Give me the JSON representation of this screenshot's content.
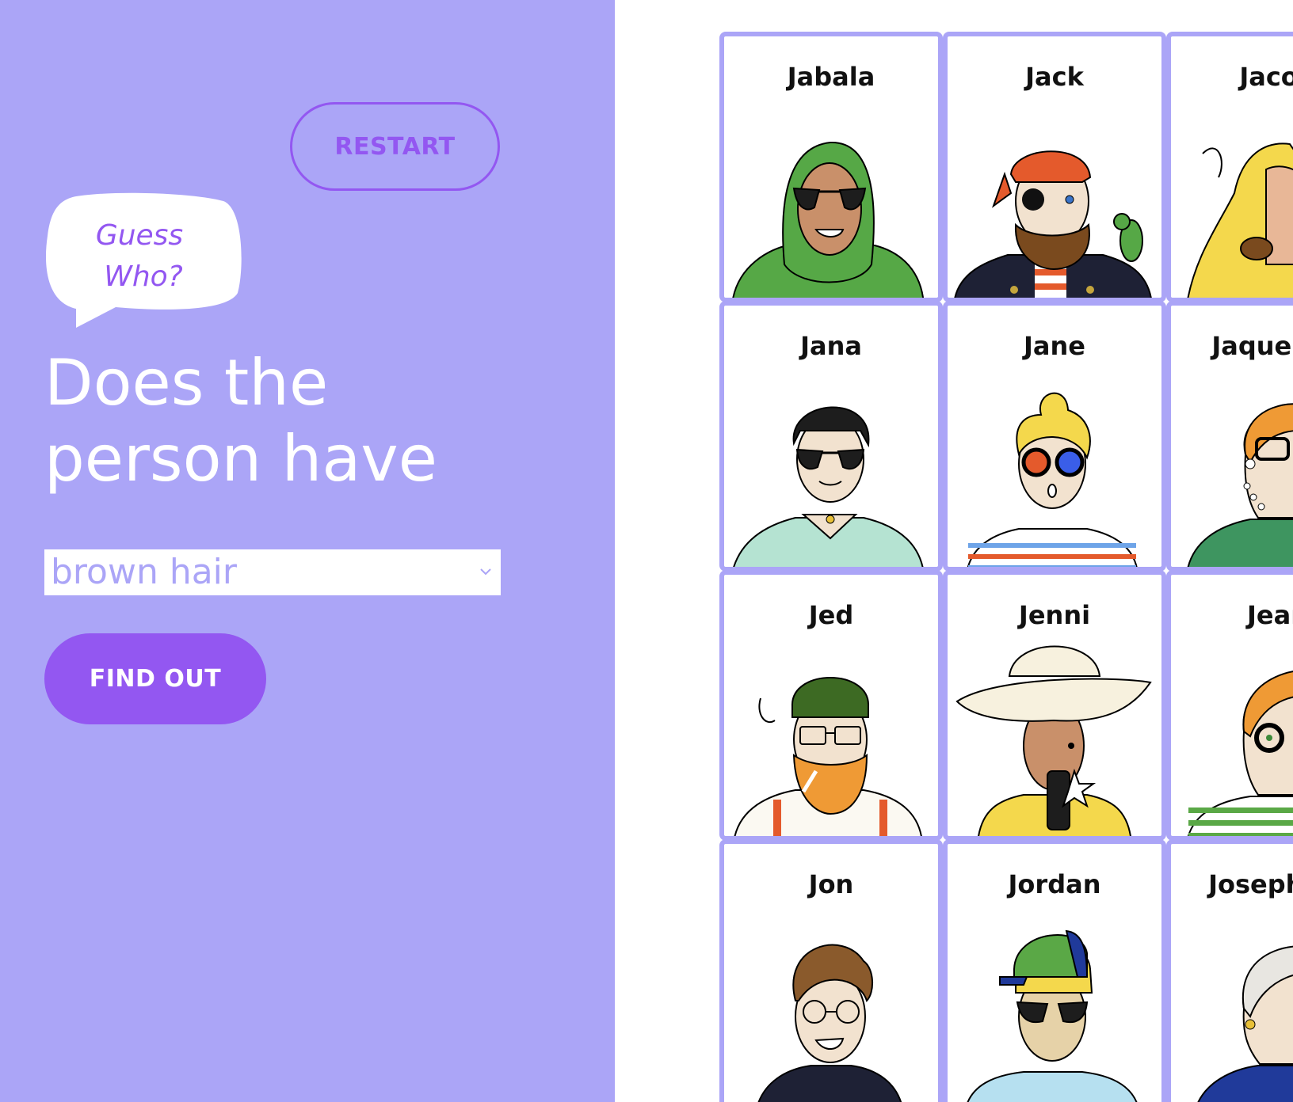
{
  "sidebar": {
    "restart_label": "RESTART",
    "bubble_line1": "Guess",
    "bubble_line2": "Who?",
    "question_line1": "Does the",
    "question_line2": "person have",
    "select_value": "brown hair",
    "find_label": "FIND OUT"
  },
  "colors": {
    "panel": "#aba5f7",
    "accent": "#9357f1",
    "card_border": "#aba5f7"
  },
  "board": {
    "cards": [
      {
        "name": "Jabala",
        "illustration": "woman-green-hijab-sunglasses"
      },
      {
        "name": "Jack",
        "illustration": "pirate-eyepatch-parrot"
      },
      {
        "name": "Jacob",
        "illustration": "yellow-raincoat-pipe"
      },
      {
        "name": "Jana",
        "illustration": "dark-hair-sunglasses-mint-shirt"
      },
      {
        "name": "Jane",
        "illustration": "blonde-bun-round-glasses-striped"
      },
      {
        "name": "Jaqueline",
        "illustration": "orange-hair-glasses-pearls"
      },
      {
        "name": "Jed",
        "illustration": "green-beanie-ginger-beard"
      },
      {
        "name": "Jenni",
        "illustration": "sun-hat-yellow-dress-phone"
      },
      {
        "name": "Jean",
        "illustration": "orange-hair-round-glasses-striped"
      },
      {
        "name": "Jon",
        "illustration": "brown-hair-glasses-dark-shirt"
      },
      {
        "name": "Jordan",
        "illustration": "green-cap-sunglasses-blue-shirt"
      },
      {
        "name": "Josephine",
        "illustration": "grey-hair-earring"
      }
    ]
  }
}
